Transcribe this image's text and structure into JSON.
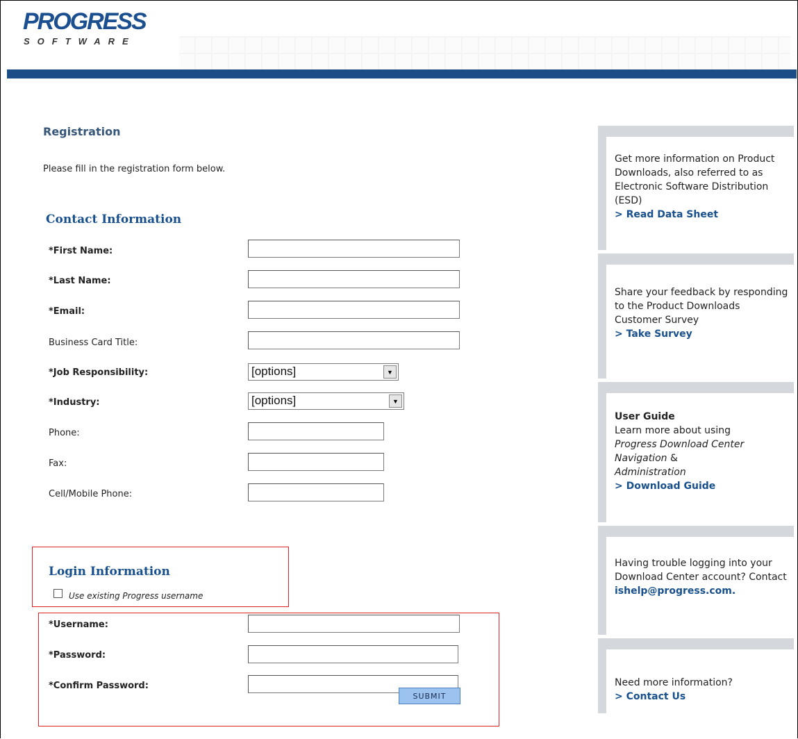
{
  "logo": {
    "title": "PROGRESS",
    "subtitle": "SOFTWARE"
  },
  "page": {
    "title": "Registration",
    "intro": "Please fill in the registration form below."
  },
  "contact": {
    "heading": "Contact Information",
    "first_name": "*First Name:",
    "last_name": "*Last Name:",
    "email": "*Email:",
    "business_card_title": "Business Card Title:",
    "job_responsibility": "*Job Responsibility:",
    "job_responsibility_value": "[options]",
    "industry": "*Industry:",
    "industry_value": "[options]",
    "phone": "Phone:",
    "fax": "Fax:",
    "cell_phone": "Cell/Mobile Phone:"
  },
  "login": {
    "heading": "Login Information",
    "use_existing_label": "Use existing Progress username",
    "username": "*Username:",
    "password": "*Password:",
    "confirm_password": "*Confirm Password:",
    "submit_label": "SUBMIT"
  },
  "sidebar": {
    "box1_text": "Get more information on Product Downloads, also referred to as Electronic Software Distribution (ESD)",
    "box1_link": "> Read Data Sheet",
    "box2_text": "Share your feedback by responding to the Product Downloads Customer Survey",
    "box2_link": "> Take Survey",
    "box3_title": "User Guide",
    "box3_text": "Learn more about using",
    "box3_italic1": "Progress Download Center Navigation",
    "box3_amp": "&",
    "box3_italic2": "Administration",
    "box3_link": "> Download Guide",
    "box4_text": "Having trouble logging into your Download Center account? Contact",
    "box4_link": "ishelp@progress.com.",
    "box5_text": "Need more information?",
    "box5_link": "> Contact Us"
  },
  "colors": {
    "brand_blue": "#1d4d86",
    "link_blue": "#17508d",
    "sidebar_gray": "#d4d7dc",
    "highlight_red": "#e02020",
    "button_blue": "#9cc2f0"
  }
}
